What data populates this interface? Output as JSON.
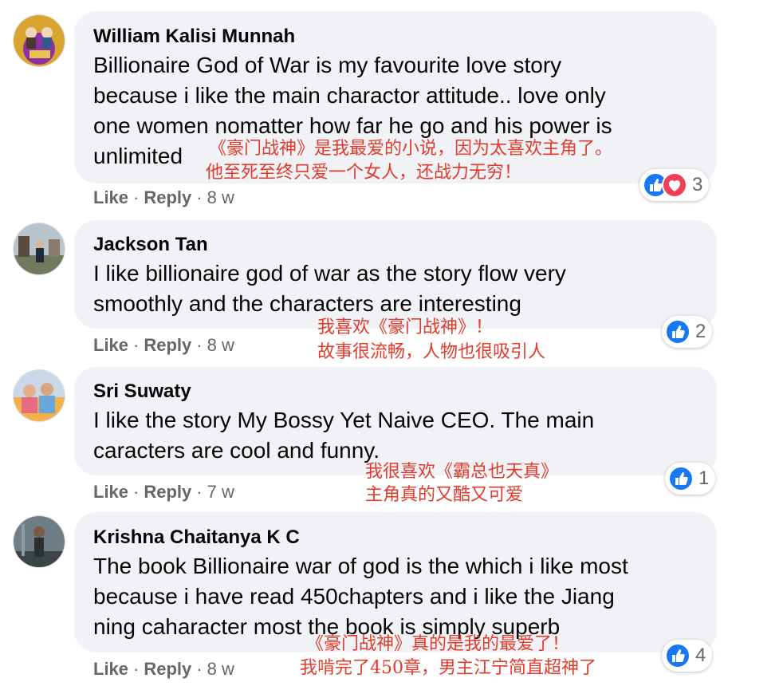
{
  "comments": [
    {
      "author": "William Kalisi Munnah",
      "lines": [
        "Billionaire God of War is my favourite love story",
        "because i like the main charactor attitude.. love only",
        "one women nomatter how far he go and his power is",
        "unlimited"
      ],
      "like_label": "Like",
      "reply_label": "Reply",
      "time": "8 w",
      "reaction_count": "3",
      "reactions": [
        "like-icon",
        "love-icon"
      ],
      "annotation": [
        "《豪门战神》是我最爱的小说，因为太喜欢主角了。",
        "他至死至终只爱一个女人，还战力无穷！"
      ]
    },
    {
      "author": "Jackson Tan",
      "lines": [
        "I like billionaire god of war as the story flow very",
        "smoothly and the characters are interesting"
      ],
      "like_label": "Like",
      "reply_label": "Reply",
      "time": "8 w",
      "reaction_count": "2",
      "reactions": [
        "like-icon"
      ],
      "annotation": [
        "我喜欢《豪门战神》！",
        "故事很流畅，人物也很吸引人"
      ]
    },
    {
      "author": "Sri Suwaty",
      "lines": [
        "I like the story My Bossy Yet Naive CEO. The main",
        "caracters are cool and funny."
      ],
      "like_label": "Like",
      "reply_label": "Reply",
      "time": "7 w",
      "reaction_count": "1",
      "reactions": [
        "like-icon"
      ],
      "annotation": [
        "我很喜欢《霸总也天真》",
        "主角真的又酷又可爱"
      ]
    },
    {
      "author": "Krishna Chaitanya K C",
      "lines": [
        "The book Billionaire war of god is the which i like most",
        "because i have read 450chapters and i like the Jiang",
        "ning caharacter most the book is simply superb"
      ],
      "like_label": "Like",
      "reply_label": "Reply",
      "time": "8 w",
      "reaction_count": "4",
      "reactions": [
        "like-icon"
      ],
      "annotation": [
        "《豪门战神》真的是我的最爱了！",
        "我啃完了450章，男主江宁简直超神了"
      ]
    }
  ],
  "colors": {
    "like_blue": "#1877f2",
    "love_red": "#f33e58",
    "annotation_red": "#e23b2c",
    "bubble_bg": "#f0f2f5"
  }
}
